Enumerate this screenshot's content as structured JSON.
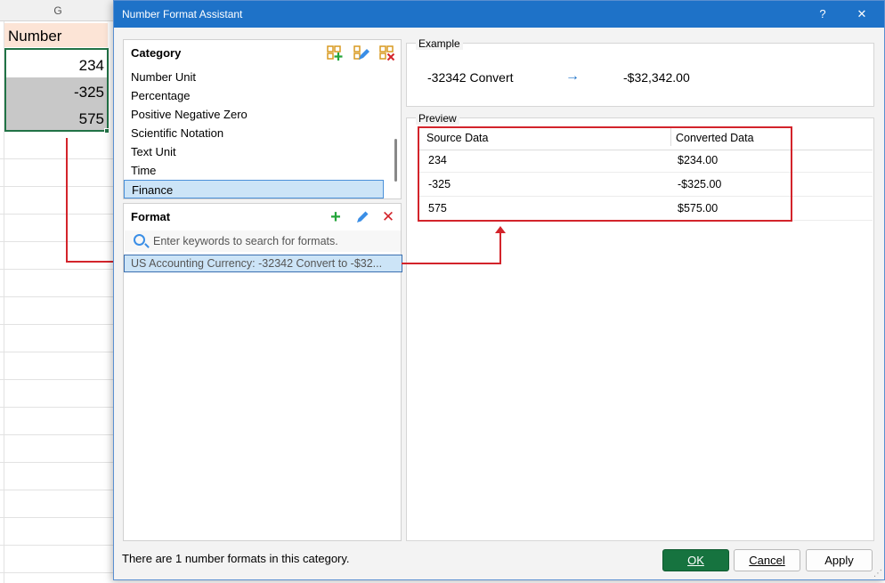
{
  "sheet": {
    "column_letter": "G",
    "header_cell": "Number",
    "cells": [
      "234",
      "-325",
      "575"
    ]
  },
  "dialog": {
    "title": "Number Format Assistant",
    "help_label": "?",
    "close_label": "✕"
  },
  "category": {
    "heading": "Category",
    "items": [
      "Number Unit",
      "Percentage",
      "Positive Negative Zero",
      "Scientific Notation",
      "Text Unit",
      "Time",
      "Finance"
    ],
    "selected": "Finance"
  },
  "format": {
    "heading": "Format",
    "search_placeholder": "Enter keywords to search for formats.",
    "items": [
      "US Accounting Currency: -32342  Convert to   -$32..."
    ]
  },
  "example": {
    "label": "Example",
    "source": "-32342  Convert",
    "arrow": "→",
    "result": "-$32,342.00"
  },
  "preview": {
    "label": "Preview",
    "columns": [
      "Source Data",
      "Converted Data"
    ],
    "rows": [
      [
        "234",
        "$234.00"
      ],
      [
        "-325",
        "-$325.00"
      ],
      [
        "575",
        "$575.00"
      ]
    ]
  },
  "footer": {
    "status": "There are 1 number formats in this category.",
    "ok_label": "OK",
    "cancel_label": "Cancel",
    "apply_label": "Apply"
  },
  "colors": {
    "title_bar": "#1e72c8",
    "ok_button": "#16733f",
    "highlight": "#d3242b",
    "selection": "#217346"
  }
}
